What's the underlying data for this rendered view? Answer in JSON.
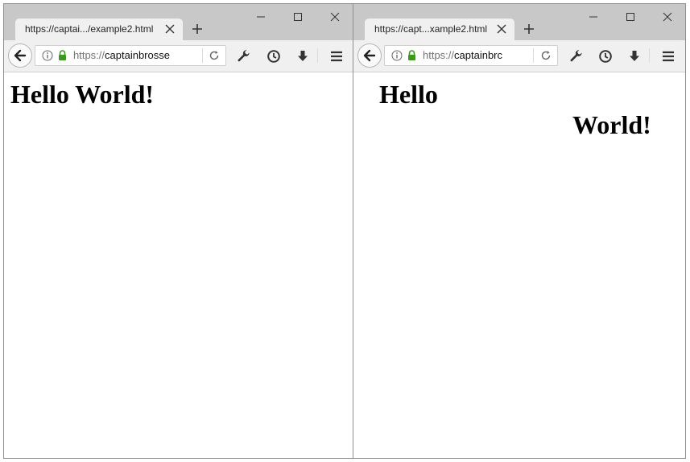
{
  "left_window": {
    "tab_title": "https://captai.../example2.html",
    "url_scheme": "https://",
    "url_host": "captainbrosse",
    "heading": "Hello World!"
  },
  "right_window": {
    "tab_title": "https://capt...xample2.html",
    "url_scheme": "https://",
    "url_host": "captainbrc",
    "heading_part1": "Hello",
    "heading_part2": "World!"
  },
  "icons": {
    "tab_close": "close-icon",
    "new_tab": "plus-icon",
    "minimize": "minimize-icon",
    "maximize": "maximize-icon",
    "close_window": "close-icon",
    "back": "arrow-left-icon",
    "info": "info-icon",
    "lock": "lock-icon",
    "reload": "reload-icon",
    "tools": "wrench-icon",
    "history": "clock-icon",
    "downloads": "download-arrow-icon",
    "menu": "hamburger-icon"
  },
  "colors": {
    "titlebar": "#c8c8c8",
    "toolbar": "#f0f0f0",
    "lock_green": "#3a9a1a",
    "url_scheme_gray": "#737373"
  }
}
